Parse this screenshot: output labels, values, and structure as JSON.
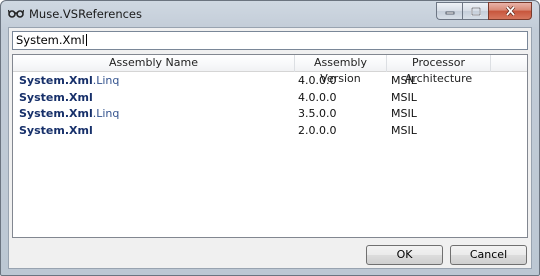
{
  "window": {
    "title": "Muse.VSReferences",
    "app_icon": "glasses-icon",
    "caption_buttons": [
      "minimize-icon",
      "maximize-icon",
      "close-icon"
    ]
  },
  "search": {
    "value": "System.Xml"
  },
  "table": {
    "columns": [
      "Assembly Name",
      "Assembly Version",
      "Processor Architecture"
    ],
    "rows": [
      {
        "name_match": "System.Xml",
        "name_rest": ".Linq",
        "version": "4.0.0.0",
        "arch": "MSIL"
      },
      {
        "name_match": "System.Xml",
        "name_rest": "",
        "version": "4.0.0.0",
        "arch": "MSIL"
      },
      {
        "name_match": "System.Xml",
        "name_rest": ".Linq",
        "version": "3.5.0.0",
        "arch": "MSIL"
      },
      {
        "name_match": "System.Xml",
        "name_rest": "",
        "version": "2.0.0.0",
        "arch": "MSIL"
      }
    ]
  },
  "buttons": {
    "ok": "OK",
    "cancel": "Cancel"
  }
}
